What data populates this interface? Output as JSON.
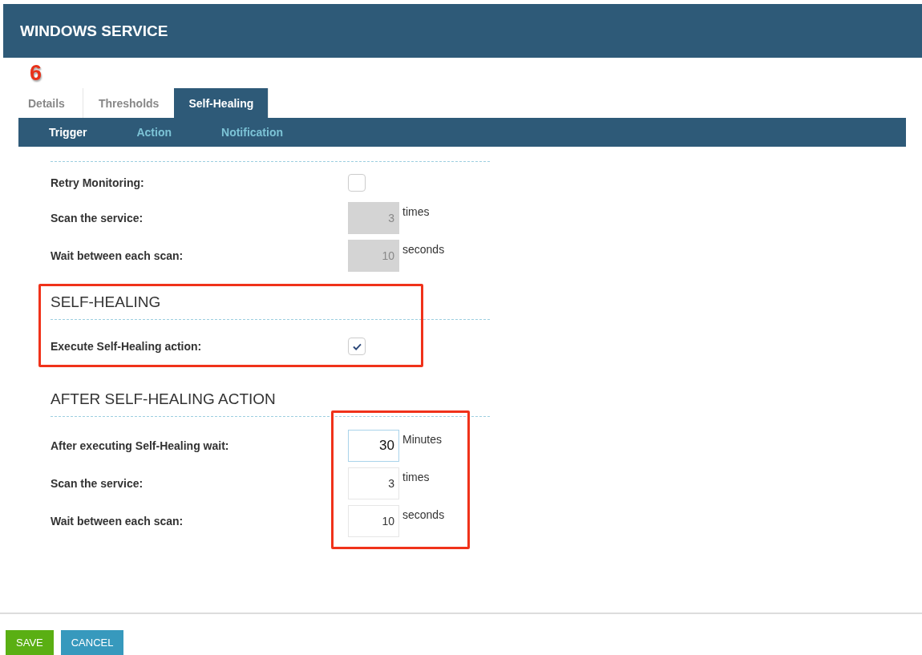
{
  "header": {
    "title": "WINDOWS SERVICE"
  },
  "callout": {
    "number": "6"
  },
  "tabs": [
    {
      "label": "Details",
      "selected": false
    },
    {
      "label": "Thresholds",
      "selected": false
    },
    {
      "label": "Self-Healing",
      "selected": true
    }
  ],
  "subtabs": [
    {
      "label": "Trigger",
      "selected": true
    },
    {
      "label": "Action",
      "selected": false
    },
    {
      "label": "Notification",
      "selected": false
    }
  ],
  "sections": [
    {
      "rows": [
        {
          "kind": "checkbox",
          "label": "Retry Monitoring:",
          "checked": false
        },
        {
          "kind": "number",
          "label": "Scan the service:",
          "value": "3",
          "unit": "times",
          "disabled": true,
          "focused": false
        },
        {
          "kind": "number",
          "label": "Wait between each scan:",
          "value": "10",
          "unit": "seconds",
          "disabled": true,
          "focused": false
        }
      ]
    },
    {
      "heading": "SELF-HEALING",
      "framed": true,
      "rows": [
        {
          "kind": "checkbox",
          "label": "Execute Self-Healing action:",
          "checked": true
        }
      ]
    },
    {
      "heading": "AFTER SELF-HEALING ACTION",
      "fields_framed": true,
      "rows": [
        {
          "kind": "number",
          "label": "After executing Self-Healing wait:",
          "value": "30",
          "unit": "Minutes",
          "disabled": false,
          "focused": true
        },
        {
          "kind": "number",
          "label": "Scan the service:",
          "value": "3",
          "unit": "times",
          "disabled": false,
          "focused": false
        },
        {
          "kind": "number",
          "label": "Wait between each scan:",
          "value": "10",
          "unit": "seconds",
          "disabled": false,
          "focused": false
        }
      ]
    }
  ],
  "buttons": [
    {
      "label": "SAVE",
      "kind": "primary"
    },
    {
      "label": "CANCEL",
      "kind": "secondary"
    }
  ]
}
